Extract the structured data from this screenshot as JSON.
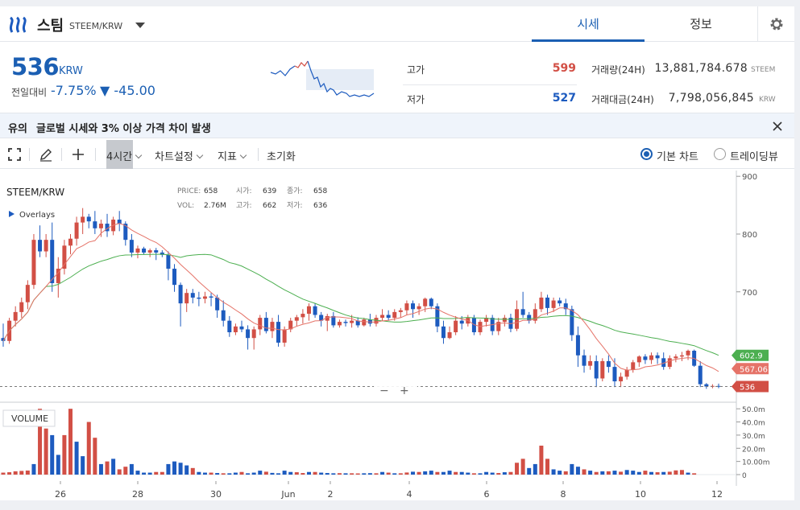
{
  "header": {
    "coin_name": "스팀",
    "pair": "STEEM/KRW",
    "tabs": [
      {
        "label": "시세",
        "active": true
      },
      {
        "label": "정보",
        "active": false
      }
    ]
  },
  "ticker": {
    "price": "536",
    "unit": "KRW",
    "change_label": "전일대비",
    "change_pct": "-7.75%",
    "change_abs": "▼ -45.00",
    "high_label": "고가",
    "high": "599",
    "low_label": "저가",
    "low": "527",
    "volume_label": "거래량(24H)",
    "volume": "13,881,784.678",
    "volume_unit": "STEEM",
    "value_label": "거래대금(24H)",
    "value": "7,798,056,845",
    "value_unit": "KRW"
  },
  "notice": {
    "tag": "유의",
    "text": "글로벌 시세와 3% 이상 가격 차이 발생"
  },
  "toolbar": {
    "interval": "4시간",
    "chart_settings": "차트설정",
    "indicators": "지표",
    "reset": "초기화",
    "view_basic": "기본 차트",
    "view_tradingview": "트레이딩뷰"
  },
  "colors": {
    "up": "#d24f45",
    "down": "#1d5bbf",
    "accent": "#1b5fb3",
    "ma_long": "#4caf50",
    "ma_short": "#e57368"
  },
  "chart_data": {
    "type": "candlestick",
    "symbol": "STEEM/KRW",
    "overlays_label": "Overlays",
    "ohlc_info": {
      "price_label": "PRICE:",
      "price": "658",
      "open_label": "시가:",
      "open": "639",
      "close_label": "종가:",
      "close": "658",
      "vol_label": "VOL:",
      "vol": "2.76M",
      "high_label": "고가:",
      "high": "662",
      "low_label": "저가:",
      "low": "636"
    },
    "price_axis": {
      "ticks": [
        900,
        800,
        700
      ],
      "ylim": [
        520,
        910
      ]
    },
    "volume_axis": {
      "label": "VOLUME",
      "ticks": [
        "50.0m",
        "40.0m",
        "30.0m",
        "20.0m",
        "10.00m",
        "0"
      ],
      "ylim": [
        0,
        55
      ]
    },
    "x_ticks": [
      "26",
      "28",
      "30",
      "Jun",
      "2",
      "4",
      "6",
      "8",
      "10",
      "12"
    ],
    "price_tags": {
      "ma_long": "602.9",
      "ma_short": "567.067",
      "last": "536"
    },
    "zoom_controls": [
      "−",
      "+"
    ],
    "candles": [
      [
        620,
        645,
        605,
        615
      ],
      [
        615,
        655,
        610,
        650
      ],
      [
        650,
        675,
        640,
        665
      ],
      [
        665,
        690,
        655,
        682
      ],
      [
        682,
        720,
        670,
        712
      ],
      [
        712,
        800,
        705,
        790
      ],
      [
        790,
        815,
        760,
        770
      ],
      [
        770,
        800,
        760,
        790
      ],
      [
        790,
        820,
        700,
        715
      ],
      [
        715,
        760,
        690,
        740
      ],
      [
        740,
        790,
        730,
        780
      ],
      [
        780,
        800,
        765,
        792
      ],
      [
        792,
        830,
        780,
        820
      ],
      [
        820,
        845,
        800,
        830
      ],
      [
        830,
        835,
        810,
        822
      ],
      [
        822,
        840,
        800,
        810
      ],
      [
        810,
        825,
        795,
        818
      ],
      [
        818,
        835,
        795,
        805
      ],
      [
        805,
        830,
        798,
        825
      ],
      [
        825,
        840,
        805,
        818
      ],
      [
        818,
        822,
        780,
        790
      ],
      [
        790,
        800,
        760,
        768
      ],
      [
        768,
        780,
        758,
        775
      ],
      [
        775,
        778,
        765,
        768
      ],
      [
        768,
        775,
        760,
        772
      ],
      [
        772,
        776,
        755,
        768
      ],
      [
        768,
        772,
        760,
        764
      ],
      [
        764,
        770,
        720,
        740
      ],
      [
        740,
        748,
        700,
        712
      ],
      [
        712,
        716,
        640,
        680
      ],
      [
        680,
        705,
        665,
        698
      ],
      [
        698,
        705,
        680,
        690
      ],
      [
        690,
        700,
        675,
        688
      ],
      [
        688,
        700,
        680,
        692
      ],
      [
        692,
        698,
        675,
        690
      ],
      [
        690,
        695,
        655,
        668
      ],
      [
        668,
        685,
        640,
        650
      ],
      [
        650,
        658,
        622,
        630
      ],
      [
        630,
        645,
        625,
        640
      ],
      [
        640,
        650,
        630,
        635
      ],
      [
        635,
        642,
        600,
        620
      ],
      [
        620,
        640,
        600,
        635
      ],
      [
        635,
        660,
        625,
        655
      ],
      [
        655,
        665,
        628,
        632
      ],
      [
        632,
        655,
        620,
        648
      ],
      [
        648,
        660,
        605,
        612
      ],
      [
        612,
        640,
        605,
        635
      ],
      [
        635,
        655,
        630,
        650
      ],
      [
        650,
        660,
        640,
        656
      ],
      [
        656,
        670,
        645,
        662
      ],
      [
        662,
        680,
        650,
        675
      ],
      [
        675,
        680,
        655,
        660
      ],
      [
        660,
        665,
        640,
        650
      ],
      [
        650,
        662,
        632,
        658
      ],
      [
        658,
        665,
        638,
        642
      ],
      [
        642,
        652,
        638,
        648
      ],
      [
        648,
        652,
        640,
        646
      ],
      [
        646,
        660,
        638,
        650
      ],
      [
        650,
        656,
        638,
        642
      ],
      [
        642,
        655,
        640,
        652
      ],
      [
        652,
        662,
        640,
        645
      ],
      [
        645,
        660,
        640,
        655
      ],
      [
        655,
        670,
        650,
        660
      ],
      [
        660,
        668,
        650,
        655
      ],
      [
        655,
        670,
        650,
        665
      ],
      [
        665,
        672,
        655,
        668
      ],
      [
        668,
        685,
        660,
        680
      ],
      [
        680,
        685,
        655,
        670
      ],
      [
        670,
        680,
        660,
        675
      ],
      [
        675,
        690,
        665,
        688
      ],
      [
        688,
        690,
        670,
        675
      ],
      [
        675,
        680,
        630,
        640
      ],
      [
        640,
        650,
        610,
        620
      ],
      [
        620,
        640,
        618,
        630
      ],
      [
        630,
        658,
        625,
        650
      ],
      [
        650,
        658,
        635,
        645
      ],
      [
        645,
        660,
        640,
        655
      ],
      [
        655,
        660,
        625,
        630
      ],
      [
        630,
        652,
        625,
        648
      ],
      [
        648,
        660,
        640,
        655
      ],
      [
        655,
        660,
        625,
        632
      ],
      [
        632,
        655,
        625,
        648
      ],
      [
        648,
        660,
        640,
        655
      ],
      [
        655,
        662,
        630,
        636
      ],
      [
        636,
        685,
        632,
        670
      ],
      [
        670,
        700,
        655,
        660
      ],
      [
        660,
        665,
        645,
        650
      ],
      [
        650,
        680,
        645,
        670
      ],
      [
        670,
        700,
        665,
        690
      ],
      [
        690,
        695,
        660,
        672
      ],
      [
        672,
        690,
        665,
        685
      ],
      [
        685,
        690,
        675,
        680
      ],
      [
        680,
        688,
        660,
        670
      ],
      [
        670,
        676,
        615,
        625
      ],
      [
        625,
        640,
        570,
        590
      ],
      [
        590,
        600,
        560,
        572
      ],
      [
        572,
        590,
        565,
        580
      ],
      [
        580,
        590,
        535,
        550
      ],
      [
        550,
        585,
        545,
        580
      ],
      [
        580,
        590,
        560,
        570
      ],
      [
        570,
        585,
        535,
        545
      ],
      [
        545,
        560,
        535,
        553
      ],
      [
        553,
        570,
        548,
        565
      ],
      [
        565,
        582,
        560,
        578
      ],
      [
        578,
        590,
        570,
        588
      ],
      [
        588,
        592,
        575,
        582
      ],
      [
        582,
        595,
        575,
        590
      ],
      [
        590,
        595,
        575,
        585
      ],
      [
        585,
        595,
        565,
        570
      ],
      [
        570,
        590,
        566,
        585
      ],
      [
        585,
        592,
        578,
        588
      ],
      [
        588,
        596,
        580,
        590
      ],
      [
        590,
        600,
        582,
        598
      ],
      [
        598,
        600,
        570,
        572
      ],
      [
        572,
        580,
        535,
        540
      ],
      [
        540,
        542,
        532,
        536
      ],
      [
        536,
        540,
        533,
        537
      ],
      [
        537,
        541,
        533,
        536
      ]
    ],
    "volumes": [
      [
        1.5,
        1
      ],
      [
        1.8,
        1
      ],
      [
        2.5,
        1
      ],
      [
        2.8,
        1
      ],
      [
        3.1,
        1
      ],
      [
        8,
        0
      ],
      [
        50,
        1
      ],
      [
        35,
        1
      ],
      [
        30,
        0
      ],
      [
        15,
        0
      ],
      [
        30,
        1
      ],
      [
        50,
        1
      ],
      [
        25,
        0
      ],
      [
        14,
        0
      ],
      [
        40,
        1
      ],
      [
        28,
        1
      ],
      [
        8,
        0
      ],
      [
        10,
        1
      ],
      [
        12,
        0
      ],
      [
        4,
        1
      ],
      [
        6,
        1
      ],
      [
        8,
        0
      ],
      [
        3,
        0
      ],
      [
        1.5,
        0
      ],
      [
        1.5,
        0
      ],
      [
        2,
        1
      ],
      [
        2,
        1
      ],
      [
        8,
        0
      ],
      [
        10,
        0
      ],
      [
        9,
        0
      ],
      [
        7,
        0
      ],
      [
        5,
        1
      ],
      [
        2,
        0
      ],
      [
        1.5,
        0
      ],
      [
        1.5,
        1
      ],
      [
        1.2,
        0
      ],
      [
        1,
        1
      ],
      [
        1,
        0
      ],
      [
        1.5,
        0
      ],
      [
        2,
        1
      ],
      [
        1,
        0
      ],
      [
        1.5,
        0
      ],
      [
        3,
        0
      ],
      [
        2.2,
        1
      ],
      [
        1.3,
        0
      ],
      [
        1,
        0
      ],
      [
        3,
        0
      ],
      [
        2,
        0
      ],
      [
        1.8,
        1
      ],
      [
        1.2,
        1
      ],
      [
        2,
        0
      ],
      [
        2,
        1
      ],
      [
        1.5,
        0
      ],
      [
        1.2,
        0
      ],
      [
        1,
        0
      ],
      [
        1.1,
        1
      ],
      [
        1,
        0
      ],
      [
        1,
        1
      ],
      [
        0.9,
        1
      ],
      [
        1,
        0
      ],
      [
        1.1,
        0
      ],
      [
        1,
        1
      ],
      [
        2,
        0
      ],
      [
        1.5,
        1
      ],
      [
        1,
        0
      ],
      [
        1,
        1
      ],
      [
        1.6,
        1
      ],
      [
        2.2,
        0
      ],
      [
        2,
        1
      ],
      [
        2.5,
        0
      ],
      [
        3,
        0
      ],
      [
        2,
        1
      ],
      [
        2,
        0
      ],
      [
        3,
        0
      ],
      [
        2,
        1
      ],
      [
        2,
        0
      ],
      [
        1.5,
        0
      ],
      [
        1,
        1
      ],
      [
        1,
        0
      ],
      [
        2,
        0
      ],
      [
        1.5,
        0
      ],
      [
        1.2,
        1
      ],
      [
        1.8,
        0
      ],
      [
        2,
        1
      ],
      [
        9,
        1
      ],
      [
        12,
        1
      ],
      [
        5,
        0
      ],
      [
        8,
        0
      ],
      [
        22,
        1
      ],
      [
        12,
        1
      ],
      [
        4,
        0
      ],
      [
        3,
        0
      ],
      [
        2.5,
        1
      ],
      [
        8,
        0
      ],
      [
        6,
        0
      ],
      [
        4,
        1
      ],
      [
        3,
        0
      ],
      [
        2,
        1
      ],
      [
        2.5,
        0
      ],
      [
        2.5,
        1
      ],
      [
        3,
        0
      ],
      [
        2.2,
        1
      ],
      [
        3.5,
        0
      ],
      [
        3,
        0
      ],
      [
        2,
        0
      ],
      [
        3,
        1
      ],
      [
        2,
        0
      ],
      [
        1.8,
        1
      ],
      [
        2,
        0
      ],
      [
        2.2,
        1
      ],
      [
        3.2,
        1
      ],
      [
        3.5,
        1
      ],
      [
        1.5,
        0
      ],
      [
        1,
        1
      ]
    ]
  }
}
